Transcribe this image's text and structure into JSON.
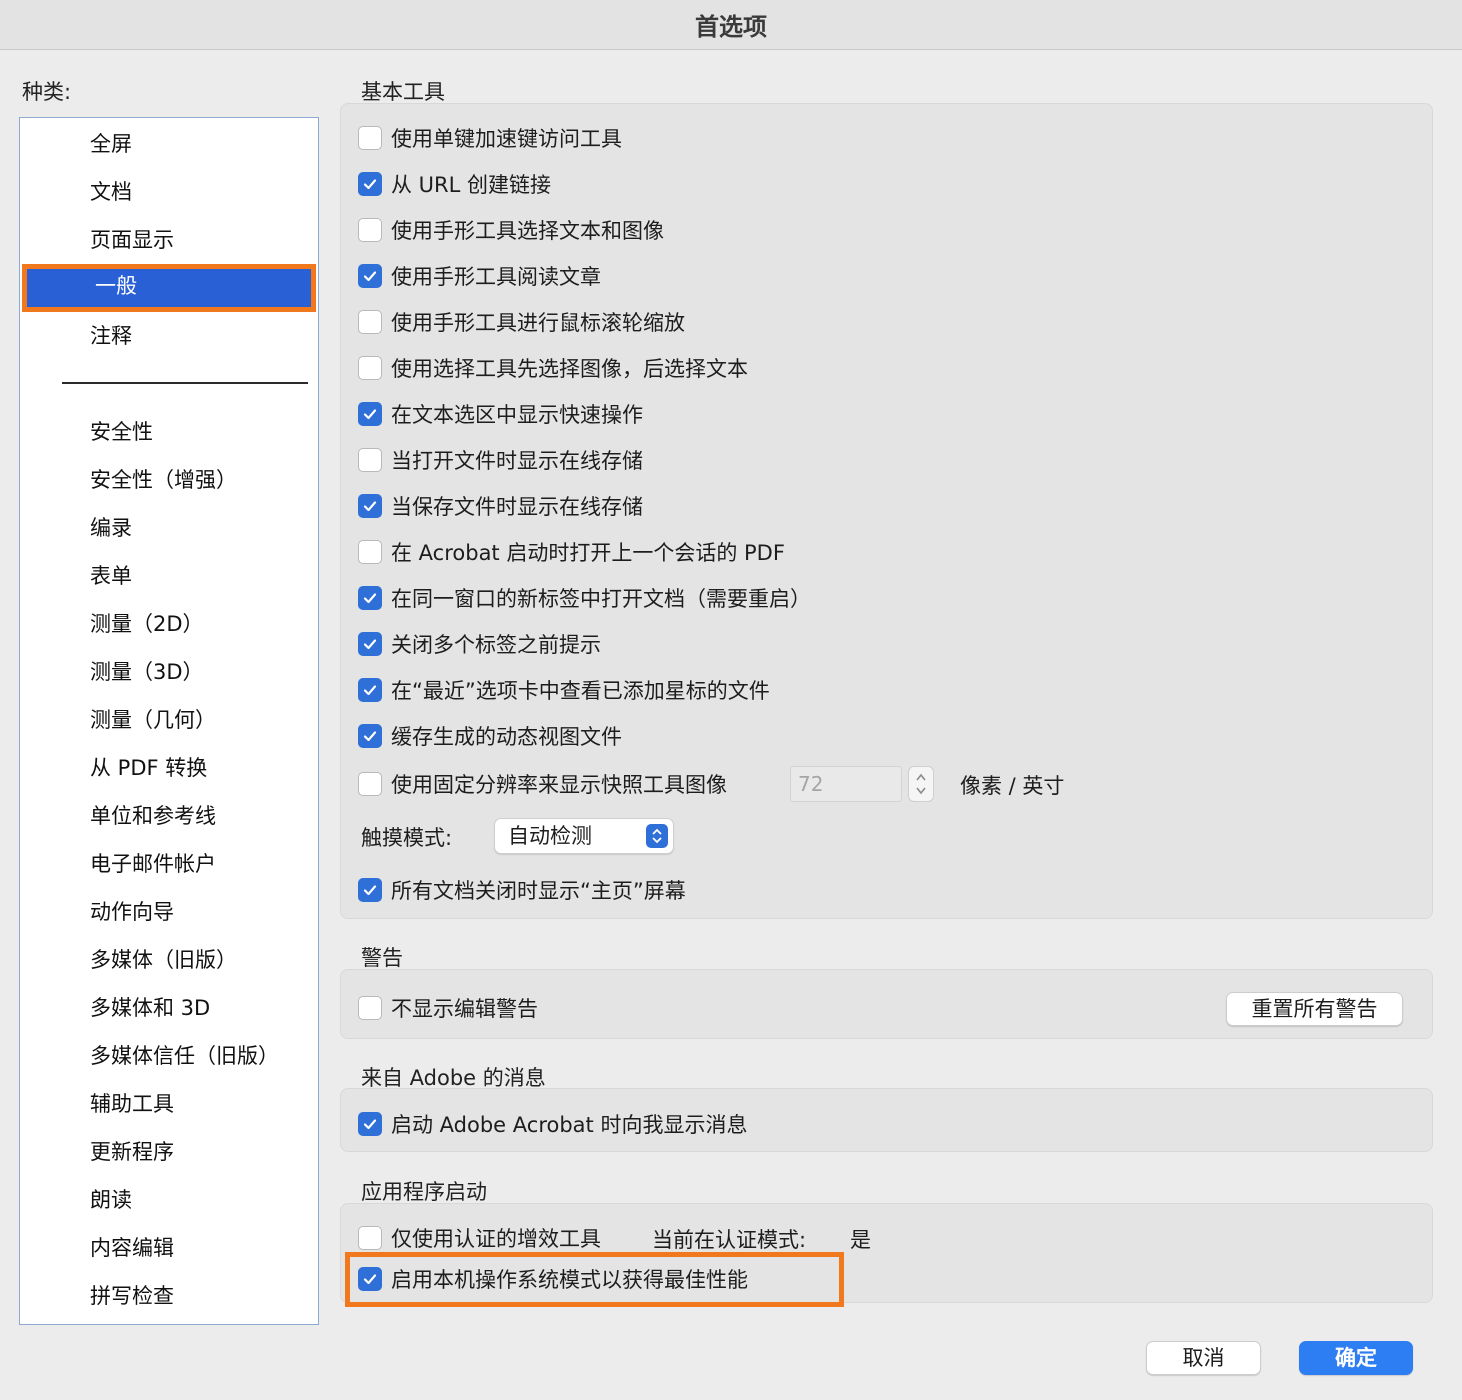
{
  "window": {
    "title": "首选项"
  },
  "sidebar": {
    "label": "种类:",
    "items_top": [
      "全屏",
      "文档",
      "页面显示",
      "一般",
      "注释"
    ],
    "selected": "一般",
    "items_bottom": [
      "安全性",
      "安全性（增强）",
      "编录",
      "表单",
      "测量（2D）",
      "测量（3D）",
      "测量（几何）",
      "从 PDF 转换",
      "单位和参考线",
      "电子邮件帐户",
      "动作向导",
      "多媒体（旧版）",
      "多媒体和 3D",
      "多媒体信任（旧版）",
      "辅助工具",
      "更新程序",
      "朗读",
      "内容编辑",
      "拼写检查"
    ]
  },
  "basic_tools": {
    "title": "基本工具",
    "options": [
      {
        "label": "使用单键加速键访问工具",
        "checked": false
      },
      {
        "label": "从 URL 创建链接",
        "checked": true
      },
      {
        "label": "使用手形工具选择文本和图像",
        "checked": false
      },
      {
        "label": "使用手形工具阅读文章",
        "checked": true
      },
      {
        "label": "使用手形工具进行鼠标滚轮缩放",
        "checked": false
      },
      {
        "label": "使用选择工具先选择图像，后选择文本",
        "checked": false
      },
      {
        "label": "在文本选区中显示快速操作",
        "checked": true
      },
      {
        "label": "当打开文件时显示在线存储",
        "checked": false
      },
      {
        "label": "当保存文件时显示在线存储",
        "checked": true
      },
      {
        "label": "在 Acrobat 启动时打开上一个会话的 PDF",
        "checked": false
      },
      {
        "label": "在同一窗口的新标签中打开文档（需要重启）",
        "checked": true
      },
      {
        "label": "关闭多个标签之前提示",
        "checked": true
      },
      {
        "label": "在“最近”选项卡中查看已添加星标的文件",
        "checked": true
      },
      {
        "label": "缓存生成的动态视图文件",
        "checked": true
      },
      {
        "label": "使用固定分辨率来显示快照工具图像",
        "checked": false
      }
    ],
    "resolution_value": "72",
    "resolution_units": "像素 / 英寸",
    "touch_mode_label": "触摸模式:",
    "touch_mode_value": "自动检测",
    "home_screen": {
      "label": "所有文档关闭时显示“主页”屏幕",
      "checked": true
    }
  },
  "warnings": {
    "title": "警告",
    "option": {
      "label": "不显示编辑警告",
      "checked": false
    },
    "reset_button": "重置所有警告"
  },
  "messages": {
    "title": "来自 Adobe 的消息",
    "option": {
      "label": "启动 Adobe Acrobat 时向我显示消息",
      "checked": true
    }
  },
  "startup": {
    "title": "应用程序启动",
    "certified_only": {
      "label": "仅使用认证的增效工具",
      "checked": false
    },
    "mode_label": "当前在认证模式:",
    "mode_value": "是",
    "native_os": {
      "label": "启用本机操作系统模式以获得最佳性能",
      "checked": true
    }
  },
  "footer": {
    "cancel": "取消",
    "ok": "确定"
  },
  "colors": {
    "accent": "#2f6fd8",
    "selection": "#2a60d6",
    "highlight": "#f2781e",
    "primary_button": "#2d7df3"
  }
}
